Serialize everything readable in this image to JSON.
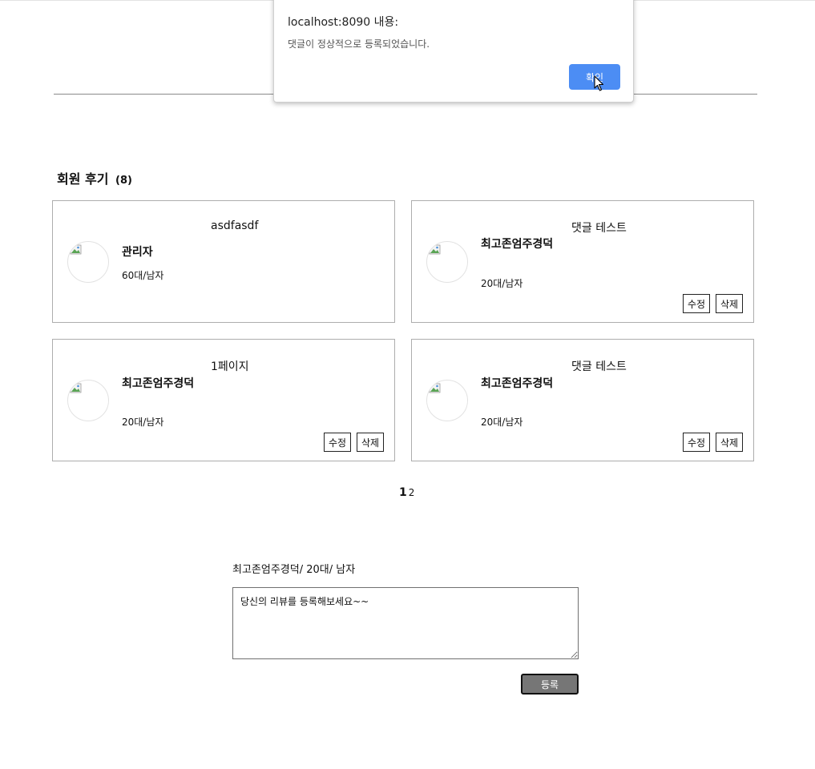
{
  "dialog": {
    "title": "localhost:8090 내용:",
    "message": "댓글이 정상적으로 등록되었습니다.",
    "ok_label": "확인"
  },
  "reviews_section": {
    "title": "회원 후기",
    "count": "(8)"
  },
  "reviews": [
    {
      "title": "asdfasdf",
      "author": "관리자",
      "meta": "60대/남자",
      "edit_label": "",
      "delete_label": ""
    },
    {
      "title": "댓글 테스트",
      "author": "최고존엄주경덕",
      "meta": "20대/남자",
      "edit_label": "수정",
      "delete_label": "삭제"
    },
    {
      "title": "1페이지",
      "author": "최고존엄주경덕",
      "meta": "20대/남자",
      "edit_label": "수정",
      "delete_label": "삭제"
    },
    {
      "title": "댓글 테스트",
      "author": "최고존엄주경덕",
      "meta": "20대/남자",
      "edit_label": "수정",
      "delete_label": "삭제"
    }
  ],
  "pagination": {
    "current": "1",
    "pages": [
      "2"
    ]
  },
  "form": {
    "writer_info": "최고존엄주경덕/ 20대/ 남자",
    "placeholder": "당신의 리뷰를 등록해보세요~~",
    "submit_label": "등록"
  },
  "colors": {
    "dialog_button": "#4c8df4",
    "submit_button": "#767676"
  }
}
